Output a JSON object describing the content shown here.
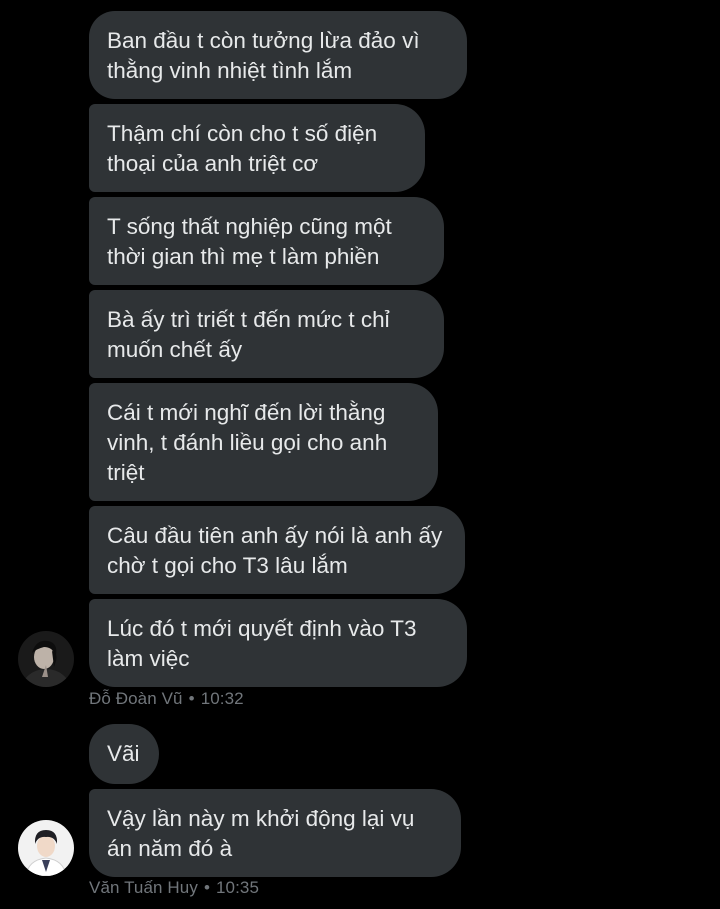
{
  "colors": {
    "background": "#000000",
    "bubble": "#2f3336",
    "text": "#e7e9ea",
    "meta": "#71767b"
  },
  "groups": [
    {
      "messages": [
        "Ban đầu t còn tưởng lừa đảo vì thằng vinh nhiệt tình lắm",
        "Thậm chí còn cho t số điện thoại của anh triệt cơ",
        "T sống thất nghiệp cũng một thời gian thì mẹ t làm phiền",
        "Bà ấy trì triết t đến mức t chỉ muốn chết ấy",
        "Cái t mới nghĩ đến lời thằng vinh, t đánh liều gọi cho anh triệt",
        "Câu đầu tiên anh ấy nói là anh ấy chờ t gọi cho T3 lâu lắm",
        "Lúc đó t mới quyết định vào T3 làm việc"
      ],
      "sender": "Đỗ Đoàn Vũ",
      "time": "10:32",
      "avatar": "avatar-dark-portrait-icon"
    },
    {
      "messages": [
        "Vãi",
        "Vậy lần này m khởi động lại vụ án năm đó à"
      ],
      "sender": "Văn Tuấn Huy",
      "time": "10:35",
      "avatar": "avatar-light-portrait-icon"
    }
  ],
  "separator": "•"
}
